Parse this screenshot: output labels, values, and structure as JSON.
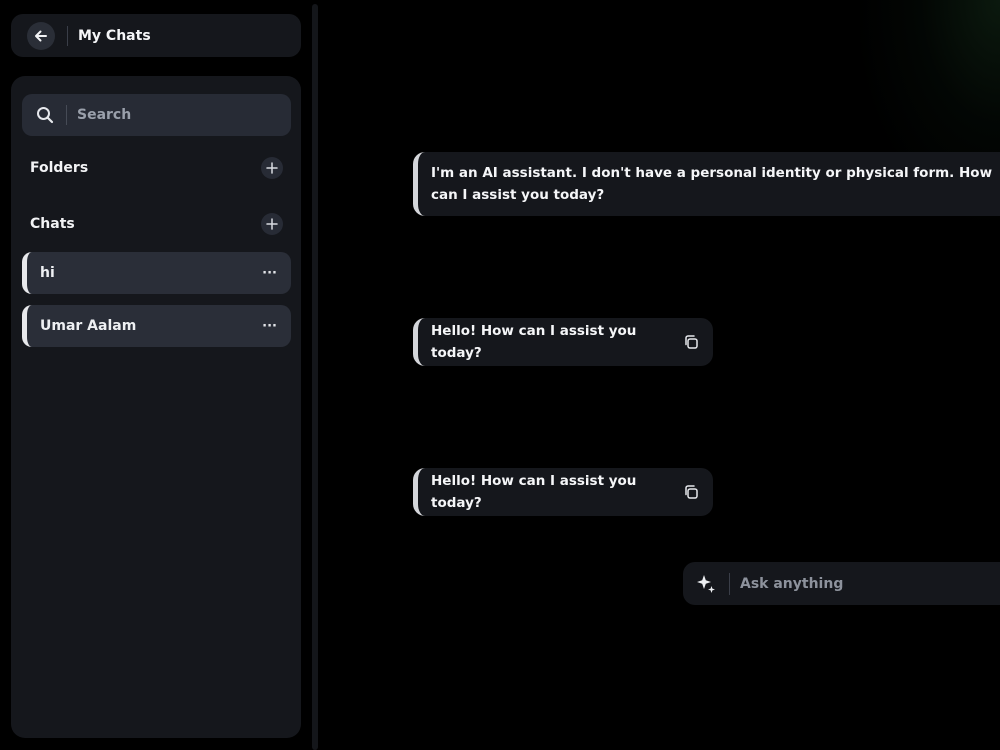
{
  "sidebar": {
    "header": {
      "title": "My Chats",
      "back_icon": "arrow-left-icon"
    },
    "search": {
      "placeholder": "Search",
      "icon": "search-icon"
    },
    "folders": {
      "label": "Folders",
      "add_icon": "plus-icon"
    },
    "chats": {
      "label": "Chats",
      "add_icon": "plus-icon",
      "items": [
        {
          "label": "hi",
          "menu": "···"
        },
        {
          "label": "Umar Aalam",
          "menu": "···"
        }
      ]
    }
  },
  "conversation": {
    "messages": [
      {
        "text": "I'm an AI assistant. I don't have a personal identity or physical form. How can I assist you today?"
      },
      {
        "text": "Hello! How can I assist you today?",
        "icon": "copy-icon"
      },
      {
        "text": "Hello! How can I assist you today?",
        "icon": "copy-icon"
      }
    ]
  },
  "composer": {
    "placeholder": "Ask anything",
    "icon": "sparkle-icon"
  },
  "colors": {
    "background": "#000000",
    "panel": "#15171c",
    "item": "#2a2e38",
    "accent_bar": "#e8e9ec",
    "glow": "#285a32"
  }
}
